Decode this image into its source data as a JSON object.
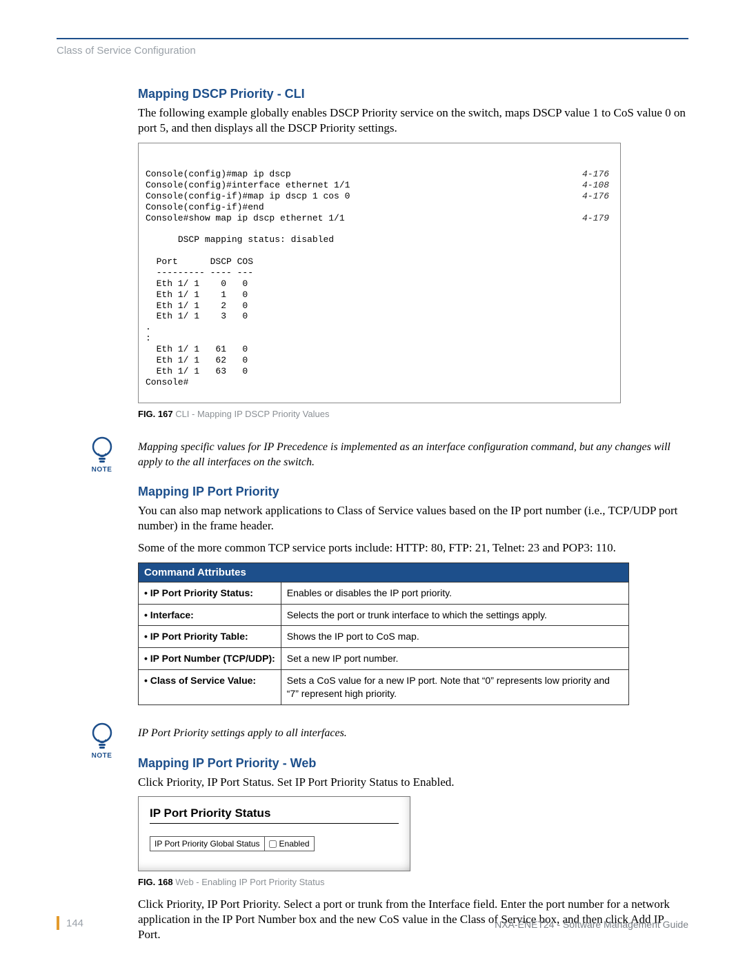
{
  "header": {
    "section": "Class of Service Configuration"
  },
  "section1": {
    "heading": "Mapping DSCP Priority - CLI",
    "intro": "The following example globally enables DSCP Priority service on the switch, maps DSCP value 1 to CoS value 0 on port 5, and then displays all the DSCP Priority settings.",
    "cli_refs": [
      {
        "cmd": "Console(config)#map ip dscp",
        "ref": "4-176"
      },
      {
        "cmd": "Console(config)#interface ethernet 1/1",
        "ref": "4-108"
      },
      {
        "cmd": "Console(config-if)#map ip dscp 1 cos 0",
        "ref": "4-176"
      },
      {
        "cmd": "Console(config-if)#end",
        "ref": ""
      },
      {
        "cmd": "Console#show map ip dscp ethernet 1/1",
        "ref": "4-179"
      }
    ],
    "cli_body": "DSCP mapping status: disabled\n\n  Port      DSCP COS\n  --------- ---- ---\n  Eth 1/ 1    0   0\n  Eth 1/ 1    1   0\n  Eth 1/ 1    2   0\n  Eth 1/ 1    3   0\n.\n:\n  Eth 1/ 1   61   0\n  Eth 1/ 1   62   0\n  Eth 1/ 1   63   0\nConsole#",
    "fig_label": "FIG. 167",
    "fig_caption": " CLI - Mapping IP DSCP Priority Values"
  },
  "note1": {
    "label": "NOTE",
    "text": "Mapping specific values for IP Precedence is implemented as an interface configuration command, but any changes will apply to the all interfaces on the switch."
  },
  "section2": {
    "heading": "Mapping IP Port Priority",
    "p1": "You can also map network applications to Class of Service values based on the IP port number (i.e., TCP/UDP port number) in the frame header.",
    "p2": "Some of the more common TCP service ports include: HTTP: 80, FTP: 21, Telnet: 23 and POP3: 110.",
    "table_header": "Command Attributes",
    "rows": [
      {
        "attr": "• IP Port Priority Status:",
        "desc": "Enables or disables the IP port priority."
      },
      {
        "attr": "• Interface:",
        "desc": "Selects the port or trunk interface to which the settings apply."
      },
      {
        "attr": "• IP Port Priority Table:",
        "desc": "Shows the IP port to CoS map."
      },
      {
        "attr": "• IP Port Number (TCP/UDP):",
        "desc": "Set a new IP port number."
      },
      {
        "attr": "• Class of Service Value:",
        "desc": "Sets a CoS value for a new IP port. Note that “0” represents low priority and “7” represent high priority."
      }
    ]
  },
  "note2": {
    "label": "NOTE",
    "text": "IP Port Priority settings apply to all interfaces."
  },
  "section3": {
    "heading": "Mapping IP Port Priority - Web",
    "p1": "Click Priority, IP Port Status. Set IP Port Priority Status to Enabled.",
    "panel_title": "IP Port Priority Status",
    "row_label": "IP Port Priority Global Status",
    "checkbox_label": "Enabled",
    "fig_label": "FIG. 168",
    "fig_caption": " Web - Enabling IP Port Priority Status",
    "p2": "Click Priority, IP Port Priority. Select a port or trunk from the Interface field. Enter the port number for a network application in the IP Port Number box and the new CoS value in the Class of Service box, and then click Add IP Port."
  },
  "footer": {
    "page": "144",
    "guide": "NXA-ENET24 - Software Management Guide"
  }
}
